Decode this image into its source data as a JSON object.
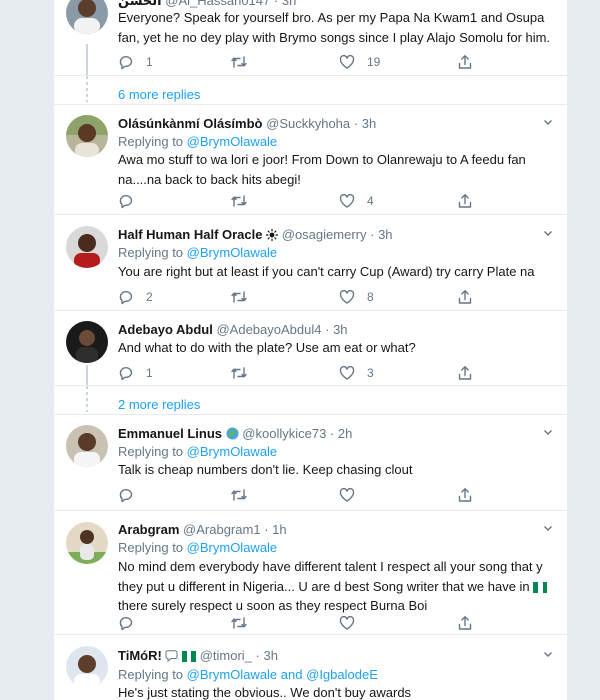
{
  "tweets": [
    {
      "name": "الحسن",
      "handle": "@Al_Hassan0147",
      "time": "3h",
      "text": "Everyone? Speak for yourself bro. As per my Papa Na Kwam1 and Osupa fan, yet he no dey play with Brymo songs since I play Alajo Somolu for him.",
      "counts": {
        "reply": "1",
        "retweet": "",
        "like": "19"
      }
    },
    {
      "name": "Olásúnkànmí Olásímbò",
      "handle": "@Suckkyhoha",
      "time": "3h",
      "replying_label": "Replying to",
      "mention": "@BrymOlawale",
      "text": "Awa mo stuff to wa lori e joor! From Down to Olanrewaju to A feedu fan na....na back to back hits abegi!",
      "counts": {
        "reply": "",
        "retweet": "",
        "like": "4"
      }
    },
    {
      "name": "Half Human Half Oracle",
      "handle": "@osagiemerry",
      "time": "3h",
      "replying_label": "Replying to",
      "mention": "@BrymOlawale",
      "text": "You are right but at least if you can't carry Cup (Award) try carry Plate na",
      "counts": {
        "reply": "2",
        "retweet": "",
        "like": "8"
      }
    },
    {
      "name": "Adebayo Abdul",
      "handle": "@AdebayoAbdul4",
      "time": "3h",
      "text": "And what to do with the plate? Use am eat or what?",
      "counts": {
        "reply": "1",
        "retweet": "",
        "like": "3"
      }
    },
    {
      "name": "Emmanuel Linus",
      "handle": "@koollykice73",
      "time": "2h",
      "replying_label": "Replying to",
      "mention": "@BrymOlawale",
      "text": "Talk is cheap numbers don't lie. Keep chasing clout",
      "counts": {
        "reply": "",
        "retweet": "",
        "like": ""
      }
    },
    {
      "name": "Arabgram",
      "handle": "@Arabgram1",
      "time": "1h",
      "replying_label": "Replying to",
      "mention": "@BrymOlawale",
      "text_line1": "No mind dem everybody have different talent I respect all your song that y",
      "text_line2": "they put u different in Nigeria... U are d best Song writer that we have in",
      "text_line3": "there surely respect u soon as they respect Burna Boi",
      "counts": {
        "reply": "",
        "retweet": "",
        "like": ""
      }
    },
    {
      "name": "TiMóR!",
      "handle": "@timori_",
      "time": "3h",
      "replying_label": "Replying to",
      "mention1": "@BrymOlawale",
      "and_word": "and",
      "mention2": "@IgbalodeE",
      "text": "He's just stating the obvious.. We don't buy awards"
    }
  ],
  "more_replies": [
    "6 more replies",
    "2 more replies"
  ],
  "dot": "·",
  "colors": {
    "link": "#1da1f2",
    "muted": "#657786",
    "text": "#14171a",
    "divider": "#e6ecf0",
    "flag_green": "#008751"
  },
  "icons": [
    "reply-icon",
    "retweet-icon",
    "like-icon",
    "share-icon",
    "caret-down-icon",
    "sun-emoji-icon",
    "globe-emoji-icon",
    "speech-bubble-emoji-icon",
    "nigeria-flag-icon"
  ]
}
